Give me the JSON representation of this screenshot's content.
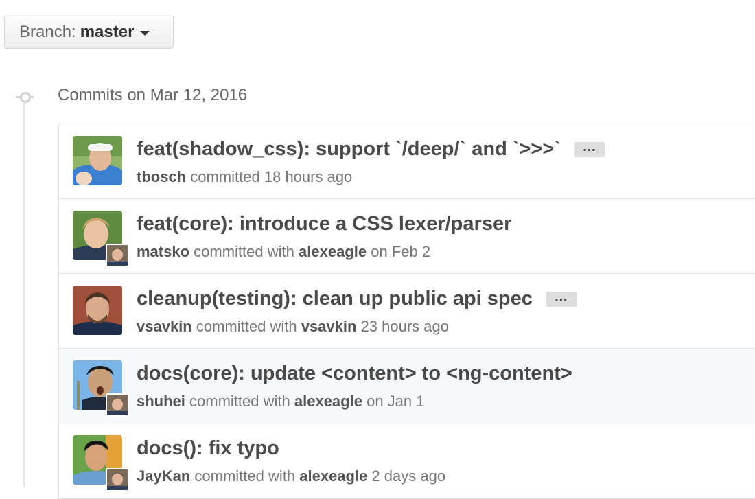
{
  "branch": {
    "prefix": "Branch:",
    "name": "master"
  },
  "group": {
    "title": "Commits on Mar 12, 2016"
  },
  "commits": [
    {
      "title": "feat(shadow_css): support `/deep/` and `>>>`",
      "author": "tbosch",
      "verb": "committed",
      "with_label": "",
      "coauthor": "",
      "time": "18 hours ago",
      "has_ellipsis": true,
      "ellipsis": "…"
    },
    {
      "title": "feat(core): introduce a CSS lexer/parser",
      "author": "matsko",
      "verb": "committed with",
      "coauthor": "alexeagle",
      "time": "on Feb 2",
      "has_ellipsis": false
    },
    {
      "title": "cleanup(testing): clean up public api spec",
      "author": "vsavkin",
      "verb": "committed with",
      "coauthor": "vsavkin",
      "time": "23 hours ago",
      "has_ellipsis": true,
      "ellipsis": "…"
    },
    {
      "title": "docs(core): update <content> to <ng-content>",
      "author": "shuhei",
      "verb": "committed with",
      "coauthor": "alexeagle",
      "time": "on Jan 1",
      "has_ellipsis": false
    },
    {
      "title": "docs(): fix typo",
      "author": "JayKan",
      "verb": "committed with",
      "coauthor": "alexeagle",
      "time": "2 days ago",
      "has_ellipsis": false
    }
  ],
  "colors": {
    "title_text": "#4a4a4a",
    "meta_text": "#767676",
    "border": "#e5e5e5",
    "highlight_row": "#f5f9fc"
  }
}
